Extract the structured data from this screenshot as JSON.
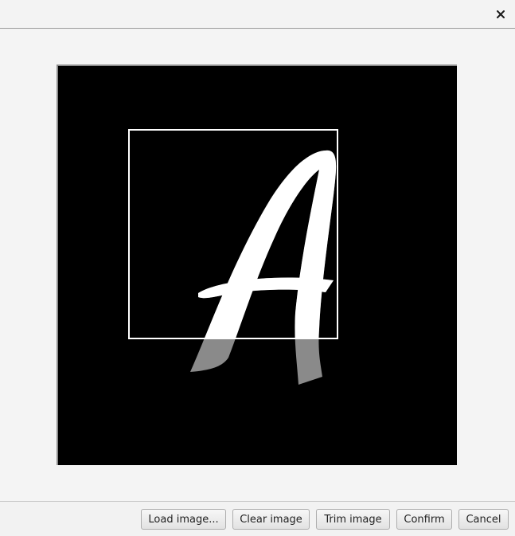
{
  "window": {
    "close_icon": "close-icon"
  },
  "editor": {
    "image_icon": "letter-a-script-glyph",
    "background_color": "#000000",
    "glyph_color": "#ffffff",
    "trim_box_color": "#ffffff"
  },
  "buttons": {
    "load_image": "Load image...",
    "clear_image": "Clear image",
    "trim_image": "Trim image",
    "confirm": "Confirm",
    "cancel": "Cancel"
  }
}
